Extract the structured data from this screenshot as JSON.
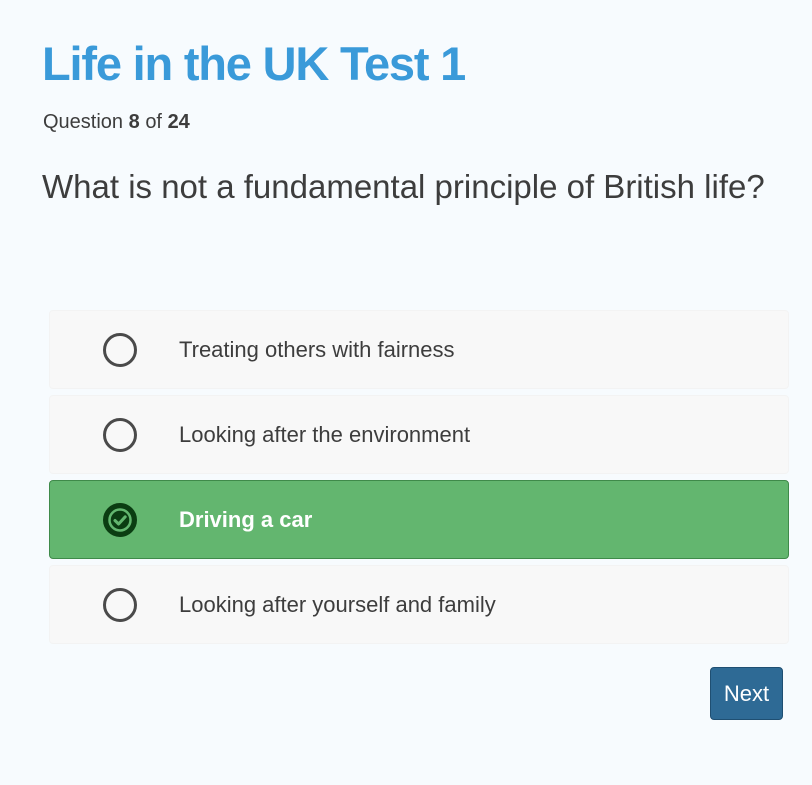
{
  "quiz": {
    "title": "Life in the UK Test 1",
    "progress": {
      "prefix": "Question",
      "current": "8",
      "separator": "of",
      "total": "24"
    },
    "question": "What is not a fundamental principle of British life?",
    "options": [
      {
        "label": "Treating others with fairness",
        "selected": false
      },
      {
        "label": "Looking after the environment",
        "selected": false
      },
      {
        "label": "Driving a car",
        "selected": true
      },
      {
        "label": "Looking after yourself and family",
        "selected": false
      }
    ],
    "next_label": "Next"
  },
  "colors": {
    "title": "#3a9ad9",
    "selected_background": "#63b66f",
    "next_button": "#2e6a95",
    "page_background": "#f7fbfe"
  },
  "icons": {
    "unselected": "radio-empty-icon",
    "selected": "check-circle-icon"
  }
}
